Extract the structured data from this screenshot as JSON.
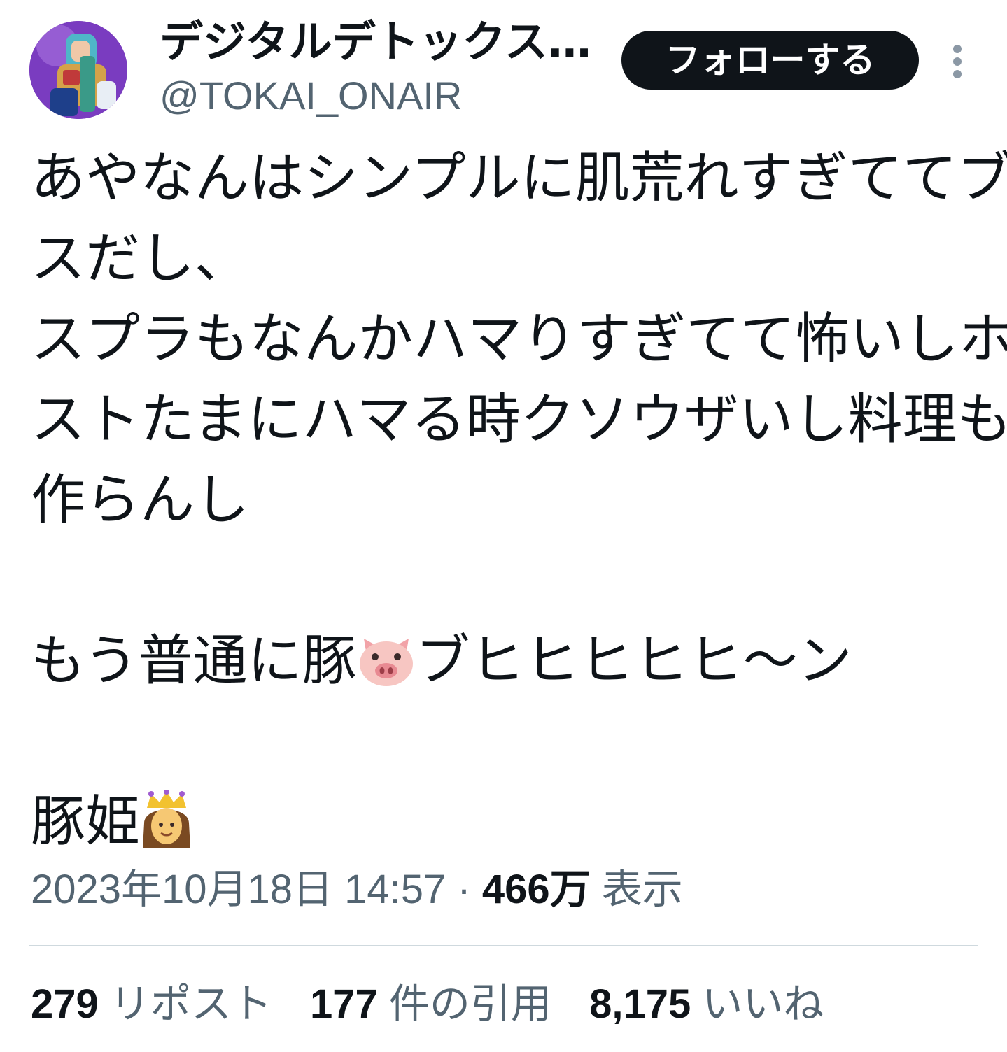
{
  "author": {
    "display_name": "デジタルデトックス…",
    "handle": "@TOKAI_ONAIR"
  },
  "follow_button": {
    "label": "フォローする"
  },
  "tweet": {
    "lines": [
      "あやなんはシンプルに肌荒れすぎててブ",
      "スだし、",
      "スプラもなんかハマりすぎてて怖いしホ",
      "ストたまにハマる時クソウザいし料理も",
      "作らんし",
      "",
      "もう普通に豚",
      "ブヒヒヒヒヒ〜ン",
      "",
      "豚姫"
    ],
    "emojis": [
      "pig-face-icon",
      "princess-icon"
    ]
  },
  "meta": {
    "timestamp": "2023年10月18日 14:57",
    "separator": " · ",
    "views_count": "466万",
    "views_label": " 表示"
  },
  "stats": {
    "reposts_count": "279",
    "reposts_label": " リポスト",
    "quotes_count": "177",
    "quotes_label": " 件の引用",
    "likes_count": "8,175",
    "likes_label": " いいね"
  },
  "colors": {
    "text_primary": "#0f1419",
    "text_secondary": "#536471",
    "button_bg": "#0f1419",
    "divider": "#cfd9de"
  }
}
